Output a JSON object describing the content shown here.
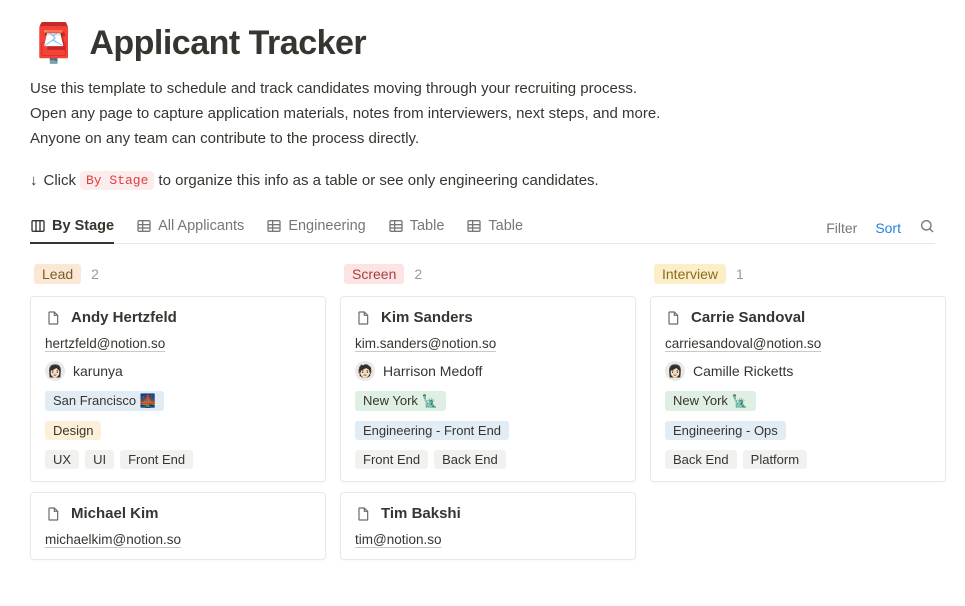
{
  "header": {
    "icon": "📮",
    "title": "Applicant Tracker"
  },
  "description": {
    "line1": "Use this template to schedule and track candidates moving through your recruiting process.",
    "line2": "Open any page to capture application materials, notes from interviewers, next steps, and more.",
    "line3": "Anyone on any team can contribute to the process directly."
  },
  "hint": {
    "arrow": "↓",
    "prefix": "Click",
    "code": "By Stage",
    "suffix": "to organize this info as a table or see only engineering candidates."
  },
  "tabs": {
    "items": [
      {
        "label": "By Stage",
        "icon": "board",
        "active": true
      },
      {
        "label": "All Applicants",
        "icon": "table",
        "active": false
      },
      {
        "label": "Engineering",
        "icon": "table",
        "active": false
      },
      {
        "label": "Table",
        "icon": "table",
        "active": false
      },
      {
        "label": "Table",
        "icon": "table",
        "active": false
      }
    ],
    "filter": "Filter",
    "sort": "Sort"
  },
  "columns": [
    {
      "name": "Lead",
      "pillClass": "pill-lead",
      "count": "2",
      "cards": [
        {
          "title": "Andy Hertzfeld",
          "email": "hertzfeld@notion.so",
          "person": "karunya",
          "avatar": "👩🏻",
          "locTags": [
            {
              "text": "San Francisco 🌉",
              "cls": "blue"
            }
          ],
          "deptTags": [
            {
              "text": "Design",
              "cls": "yellow"
            }
          ],
          "skillTags": [
            {
              "text": "UX",
              "cls": ""
            },
            {
              "text": "UI",
              "cls": ""
            },
            {
              "text": "Front End",
              "cls": ""
            }
          ]
        },
        {
          "title": "Michael Kim",
          "email": "michaelkim@notion.so"
        }
      ]
    },
    {
      "name": "Screen",
      "pillClass": "pill-screen",
      "count": "2",
      "cards": [
        {
          "title": "Kim Sanders",
          "email": "kim.sanders@notion.so",
          "person": "Harrison Medoff",
          "avatar": "🧑🏻",
          "locTags": [
            {
              "text": "New York 🗽",
              "cls": "green"
            }
          ],
          "deptTags": [
            {
              "text": "Engineering - Front End",
              "cls": "blue"
            }
          ],
          "skillTags": [
            {
              "text": "Front End",
              "cls": ""
            },
            {
              "text": "Back End",
              "cls": ""
            }
          ]
        },
        {
          "title": "Tim Bakshi",
          "email": "tim@notion.so"
        }
      ]
    },
    {
      "name": "Interview",
      "pillClass": "pill-interview",
      "count": "1",
      "cards": [
        {
          "title": "Carrie Sandoval",
          "email": "carriesandoval@notion.so",
          "person": "Camille Ricketts",
          "avatar": "👩🏻",
          "locTags": [
            {
              "text": "New York 🗽",
              "cls": "green"
            }
          ],
          "deptTags": [
            {
              "text": "Engineering - Ops",
              "cls": "blue"
            }
          ],
          "skillTags": [
            {
              "text": "Back End",
              "cls": ""
            },
            {
              "text": "Platform",
              "cls": ""
            }
          ]
        }
      ]
    }
  ]
}
